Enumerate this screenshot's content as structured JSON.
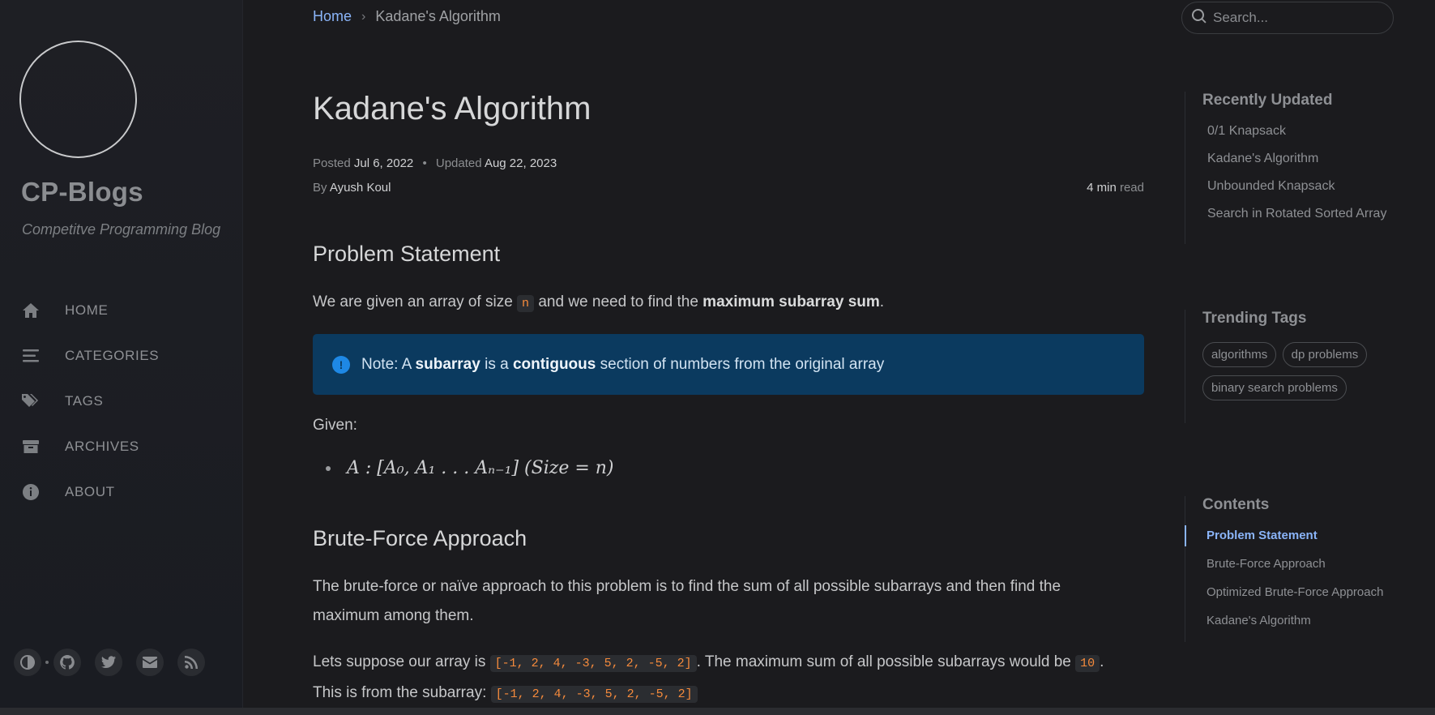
{
  "sidebar": {
    "site_title": "CP-Blogs",
    "site_subtitle": "Competitve Programming Blog",
    "nav": [
      {
        "label": "HOME",
        "icon": "home-icon"
      },
      {
        "label": "CATEGORIES",
        "icon": "stream-icon"
      },
      {
        "label": "TAGS",
        "icon": "tags-icon"
      },
      {
        "label": "ARCHIVES",
        "icon": "archive-icon"
      },
      {
        "label": "ABOUT",
        "icon": "info-circle-icon"
      }
    ],
    "bottom_icons": [
      "theme-toggle-icon",
      "github-icon",
      "twitter-icon",
      "email-icon",
      "rss-icon"
    ]
  },
  "topbar": {
    "breadcrumb_home": "Home",
    "breadcrumb_sep": "›",
    "breadcrumb_current": "Kadane's Algorithm",
    "search_placeholder": "Search..."
  },
  "post": {
    "title": "Kadane's Algorithm",
    "posted_label": "Posted",
    "posted_date": "Jul 6, 2022",
    "updated_label": "Updated",
    "updated_date": "Aug 22, 2023",
    "by_label": "By",
    "author": "Ayush Koul",
    "read_time": "4 min",
    "read_label": "read",
    "h_problem": "Problem Statement",
    "p1_a": "We are given an array of size ",
    "p1_code": "n",
    "p1_b": " and we need to find the ",
    "p1_bold": "maximum subarray sum",
    "p1_c": ".",
    "note_a": "Note: A ",
    "note_b1": "subarray",
    "note_c": " is a ",
    "note_b2": "contiguous",
    "note_d": " section of numbers from the original array",
    "given": "Given:",
    "math": "A : [A₀, A₁ . . . Aₙ₋₁] (Size = n)",
    "h_brute": "Brute-Force Approach",
    "p2": "The brute-force or naïve approach to this problem is to find the sum of all possible subarrays and then find the maximum among them.",
    "p3_a": "Lets suppose our array is ",
    "p3_code1": "[-1, 2, 4, -3, 5, 2, -5, 2]",
    "p3_b": ". The maximum sum of all possible subarrays would be ",
    "p3_code2": "10",
    "p3_c": ".",
    "p4_a": "This is from the subarray: ",
    "p4_code": "[-1, 2, 4, -3, 5, 2, -5, 2]"
  },
  "panel": {
    "recent_title": "Recently Updated",
    "recent": [
      "0/1 Knapsack",
      "Kadane's Algorithm",
      "Unbounded Knapsack",
      "Search in Rotated Sorted Array"
    ],
    "tags_title": "Trending Tags",
    "tags": [
      "algorithms",
      "dp problems",
      "binary search problems"
    ],
    "toc_title": "Contents",
    "toc": [
      "Problem Statement",
      "Brute-Force Approach",
      "Optimized Brute-Force Approach",
      "Kadane's Algorithm"
    ]
  },
  "colors": {
    "accent": "#8ab4f8",
    "code": "#f58a3c",
    "note_bg": "#0b3a5f",
    "background": "#1b1b1e"
  }
}
